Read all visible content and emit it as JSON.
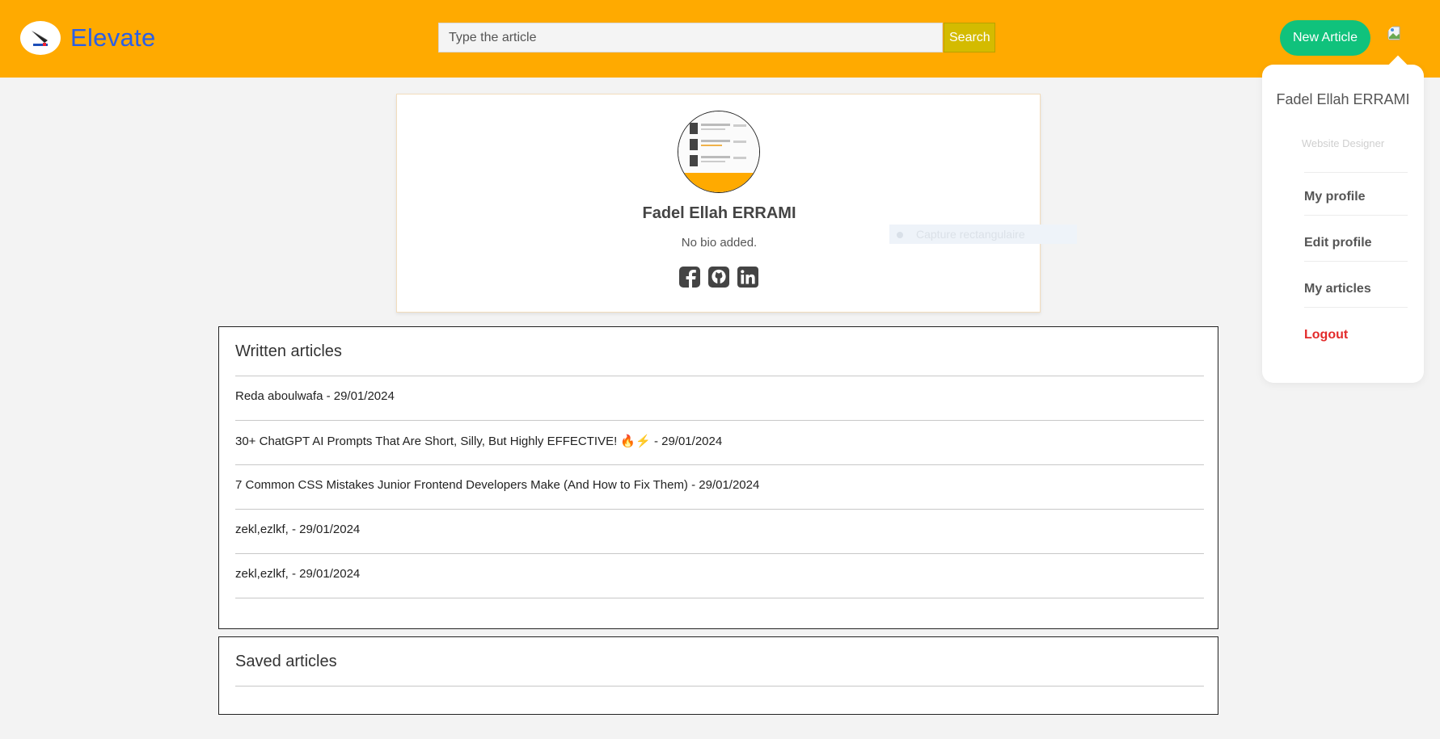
{
  "header": {
    "brand": "Elevate",
    "search_placeholder": "Type the article",
    "search_button": "Search",
    "new_article_button": "New Article",
    "colors": {
      "bar": "#ffaa00",
      "brand": "#2a5fe6",
      "search_button": "#d4bb00",
      "new_article": "#10c27c"
    }
  },
  "dropdown": {
    "name": "Fadel Ellah ERRAMI",
    "role": "Website Designer",
    "items": [
      "My profile",
      "Edit profile",
      "My articles",
      "Logout"
    ]
  },
  "profile": {
    "name": "Fadel Ellah ERRAMI",
    "bio": "No bio added.",
    "socials": [
      "facebook-icon",
      "github-icon",
      "linkedin-icon"
    ]
  },
  "overlay": {
    "label": "Capture rectangulaire"
  },
  "written": {
    "title": "Written articles",
    "articles": [
      "Reda aboulwafa - 29/01/2024",
      "30+ ChatGPT AI Prompts That Are Short, Silly, But Highly EFFECTIVE! 🔥⚡ - 29/01/2024",
      "7 Common CSS Mistakes Junior Frontend Developers Make (And How to Fix Them) - 29/01/2024",
      "zekl,ezlkf, - 29/01/2024",
      "zekl,ezlkf, - 29/01/2024"
    ]
  },
  "saved": {
    "title": "Saved articles"
  }
}
